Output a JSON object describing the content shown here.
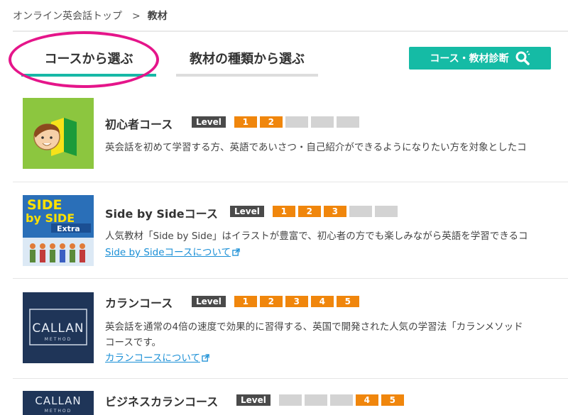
{
  "breadcrumb": {
    "home": "オンライン英会話トップ",
    "separator": ">",
    "current": "教材"
  },
  "tabs": {
    "course": "コースから選ぶ",
    "material": "教材の種類から選ぶ"
  },
  "diagnosis_button": "コース・教材診断",
  "level_label": "Level",
  "courses": [
    {
      "name": "初心者コース",
      "levels": [
        "1",
        "2",
        "",
        "",
        ""
      ],
      "active": [
        true,
        true,
        false,
        false,
        false
      ],
      "desc": "英会話を初めて学習する方、英語であいさつ・自己紹介ができるようになりたい方を対象としたコ"
    },
    {
      "name": "Side by Sideコース",
      "levels": [
        "1",
        "2",
        "3",
        "",
        ""
      ],
      "active": [
        true,
        true,
        true,
        false,
        false
      ],
      "desc": "人気教材「Side by Side」はイラストが豊富で、初心者の方でも楽しみながら英語を学習できるコ",
      "link": "Side by Sideコースについて",
      "thumb_title1": "SIDE",
      "thumb_title2": "by SIDE",
      "thumb_sub": "Extra"
    },
    {
      "name": "カランコース",
      "levels": [
        "1",
        "2",
        "3",
        "4",
        "5"
      ],
      "active": [
        true,
        true,
        true,
        true,
        true
      ],
      "desc": "英会話を通常の4倍の速度で効果的に習得する、英国で開発された人気の学習法「カランメソッド",
      "desc2": "コースです。",
      "link": "カランコースについて",
      "thumb_logo": "CALLAN",
      "thumb_sub": "METHOD"
    },
    {
      "name": "ビジネスカランコース",
      "levels": [
        "",
        "",
        "",
        "4",
        "5"
      ],
      "active": [
        false,
        false,
        false,
        true,
        true
      ],
      "thumb_logo": "CALLAN",
      "thumb_sub": "METHOD"
    }
  ],
  "colors": {
    "accent_teal": "#15bba5",
    "level_on": "#f0860c",
    "level_off": "#d3d3d3",
    "highlight_circle": "#e5158a",
    "link": "#1a8fd6"
  }
}
